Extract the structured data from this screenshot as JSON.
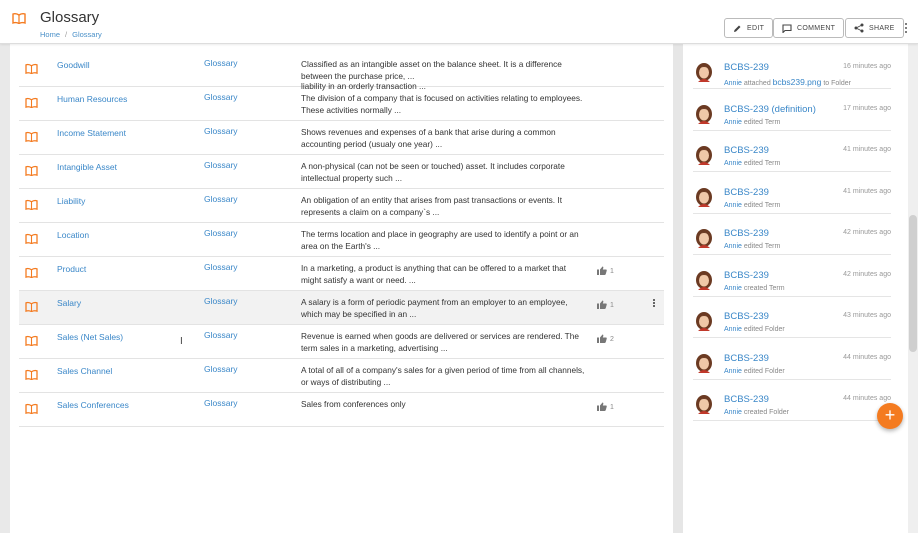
{
  "header": {
    "title": "Glossary",
    "breadcrumb": [
      "Home",
      "Glossary"
    ],
    "buttons": {
      "edit": "EDIT",
      "comment": "COMMENT",
      "share": "SHARE"
    }
  },
  "table": {
    "cutoff_text": "liability in an orderly transaction ...",
    "rows": [
      {
        "name": "Goodwill",
        "type": "Glossary",
        "desc": "Classified as an intangible asset on the balance sheet. It is a difference between the purchase price, ...",
        "likes": ""
      },
      {
        "name": "Human Resources",
        "type": "Glossary",
        "desc": "The division of a company that is focused on activities relating to employees. These activities normally ...",
        "likes": ""
      },
      {
        "name": "Income Statement",
        "type": "Glossary",
        "desc": "Shows revenues and expenses of a bank that arise during a common accounting period (usualy one year) ...",
        "likes": ""
      },
      {
        "name": "Intangible Asset",
        "type": "Glossary",
        "desc": "A non-physical (can not be seen or touched) asset. It includes corporate intellectual property such ...",
        "likes": ""
      },
      {
        "name": "Liability",
        "type": "Glossary",
        "desc": "An obligation of an entity that arises from past transactions or events. It represents a claim on a company`s ...",
        "likes": ""
      },
      {
        "name": "Location",
        "type": "Glossary",
        "desc": "The terms location and place in geography are used to identify a point or an area on the Earth's ...",
        "likes": ""
      },
      {
        "name": "Product",
        "type": "Glossary",
        "desc": "In a marketing, a product is anything that can be offered to a market that might satisfy a want or need. ...",
        "likes": "1"
      },
      {
        "name": "Salary",
        "type": "Glossary",
        "desc": "A salary is a form of periodic payment from an employer to an employee, which may be specified in an ...",
        "likes": "1"
      },
      {
        "name": "Sales (Net Sales)",
        "type": "Glossary",
        "desc": "Revenue is earned when goods are delivered or services are rendered. The term sales in a marketing, advertising ...",
        "likes": "2"
      },
      {
        "name": "Sales Channel",
        "type": "Glossary",
        "desc": "A total of all of a company's sales for a given period of time from all channels, or ways of distributing ...",
        "likes": ""
      },
      {
        "name": "Sales Conferences",
        "type": "Glossary",
        "desc": "Sales from conferences only",
        "likes": "1"
      }
    ]
  },
  "activity": [
    {
      "title": "BCBS-239",
      "user": "Annie",
      "action": "attached",
      "file": "bcbs239.png",
      "suffix": "to Folder",
      "time": "16 minutes ago"
    },
    {
      "title": "BCBS-239 (definition)",
      "user": "Annie",
      "action": "edited Term",
      "file": "",
      "suffix": "",
      "time": "17 minutes ago"
    },
    {
      "title": "BCBS-239",
      "user": "Annie",
      "action": "edited Term",
      "file": "",
      "suffix": "",
      "time": "41 minutes ago"
    },
    {
      "title": "BCBS-239",
      "user": "Annie",
      "action": "edited Term",
      "file": "",
      "suffix": "",
      "time": "41 minutes ago"
    },
    {
      "title": "BCBS-239",
      "user": "Annie",
      "action": "edited Term",
      "file": "",
      "suffix": "",
      "time": "42 minutes ago"
    },
    {
      "title": "BCBS-239",
      "user": "Annie",
      "action": "created Term",
      "file": "",
      "suffix": "",
      "time": "42 minutes ago"
    },
    {
      "title": "BCBS-239",
      "user": "Annie",
      "action": "edited Folder",
      "file": "",
      "suffix": "",
      "time": "43 minutes ago"
    },
    {
      "title": "BCBS-239",
      "user": "Annie",
      "action": "edited Folder",
      "file": "",
      "suffix": "",
      "time": "44 minutes ago"
    },
    {
      "title": "BCBS-239",
      "user": "Annie",
      "action": "created Folder",
      "file": "",
      "suffix": "",
      "time": "44 minutes ago"
    }
  ],
  "fab": {
    "label": "+"
  },
  "colors": {
    "accent": "#f47b20",
    "link": "#3a87c8"
  }
}
